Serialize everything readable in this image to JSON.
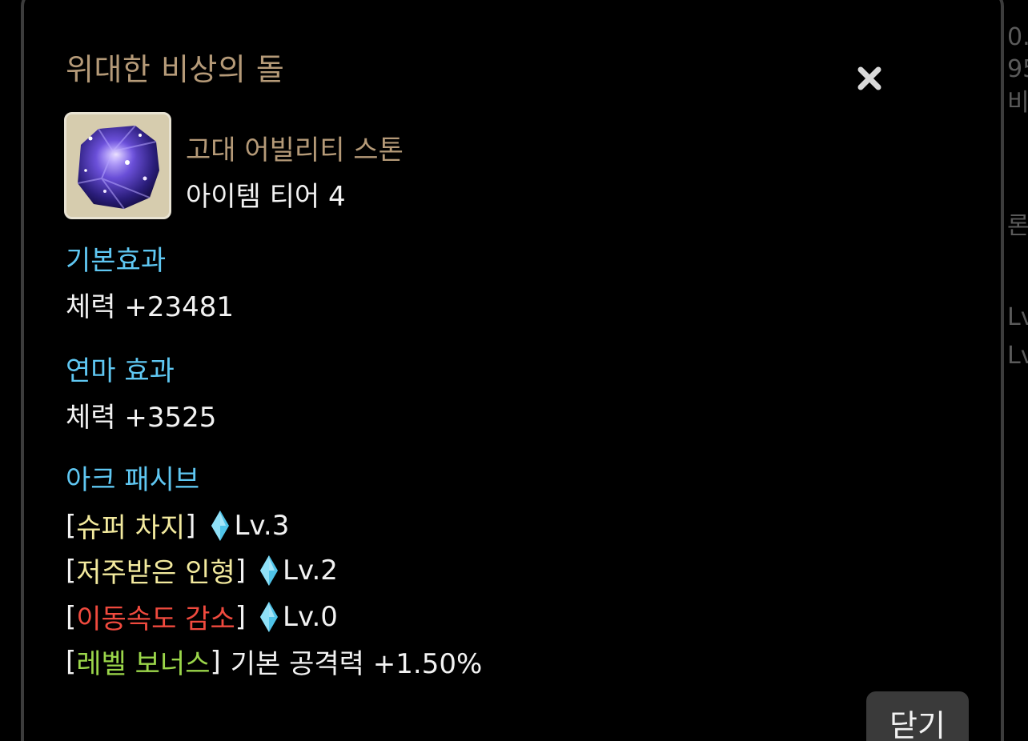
{
  "background_fragments": [
    "0.",
    "95",
    "비속",
    "론스",
    "Lv",
    "Lv"
  ],
  "modal": {
    "title": "위대한 비상의 돌",
    "close_icon": "close-icon",
    "item": {
      "icon": "ability-stone-icon",
      "name": "고대 어빌리티 스톤",
      "tier": "아이템 티어 4"
    },
    "sections": {
      "base": {
        "heading": "기본효과",
        "value": "체력 +23481"
      },
      "polish": {
        "heading": "연마 효과",
        "value": "체력 +3525"
      },
      "ark_passive": {
        "heading": "아크 패시브",
        "items": [
          {
            "open": "[",
            "name": "슈퍼 차지",
            "close": "]",
            "level": "Lv.3",
            "color": "#f3ea9e"
          },
          {
            "open": "[",
            "name": "저주받은 인형",
            "close": "]",
            "level": "Lv.2",
            "color": "#f3ea9e"
          },
          {
            "open": "[",
            "name": "이동속도 감소",
            "close": "]",
            "level": "Lv.0",
            "color": "#f04a3e"
          }
        ],
        "bonus": {
          "open": "[",
          "name": "레벨 보너스",
          "close": "]",
          "text": "기본 공격력 +1.50%",
          "color": "#9bd64a"
        }
      }
    },
    "close_button": "닫기"
  },
  "colors": {
    "title": "#b59a78",
    "section_heading": "#5fc7f2",
    "text": "#f2f2f2",
    "button_bg": "#3a3a3a"
  }
}
